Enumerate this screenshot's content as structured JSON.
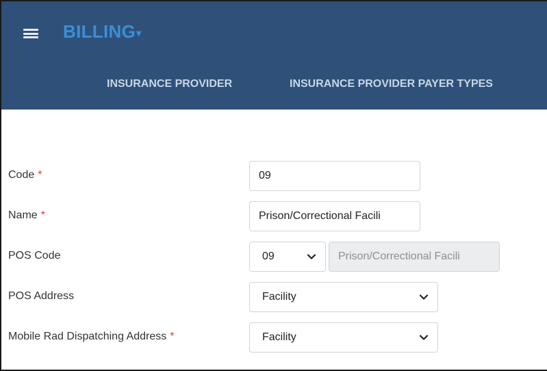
{
  "header": {
    "module_title": "BILLING",
    "module_caret": "▾",
    "tabs": [
      {
        "label": "INSURANCE PROVIDER"
      },
      {
        "label": "INSURANCE PROVIDER PAYER TYPES"
      }
    ],
    "background_color": "#2f5179",
    "title_color": "#3a8fd8"
  },
  "form": {
    "required_marker": "*",
    "required_color": "#d9383a",
    "code": {
      "label": "Code",
      "value": "09"
    },
    "name": {
      "label": "Name",
      "value": "Prison/Correctional Facili"
    },
    "pos_code": {
      "label": "POS Code",
      "selected": "09",
      "description": "Prison/Correctional Facili"
    },
    "pos_address": {
      "label": "POS Address",
      "selected": "Facility"
    },
    "mobile_rad_dispatching_address": {
      "label": "Mobile Rad Dispatching Address",
      "selected": "Facility"
    }
  },
  "icons": {
    "menu": "hamburger-icon",
    "dropdown": "chevron-down-icon"
  }
}
